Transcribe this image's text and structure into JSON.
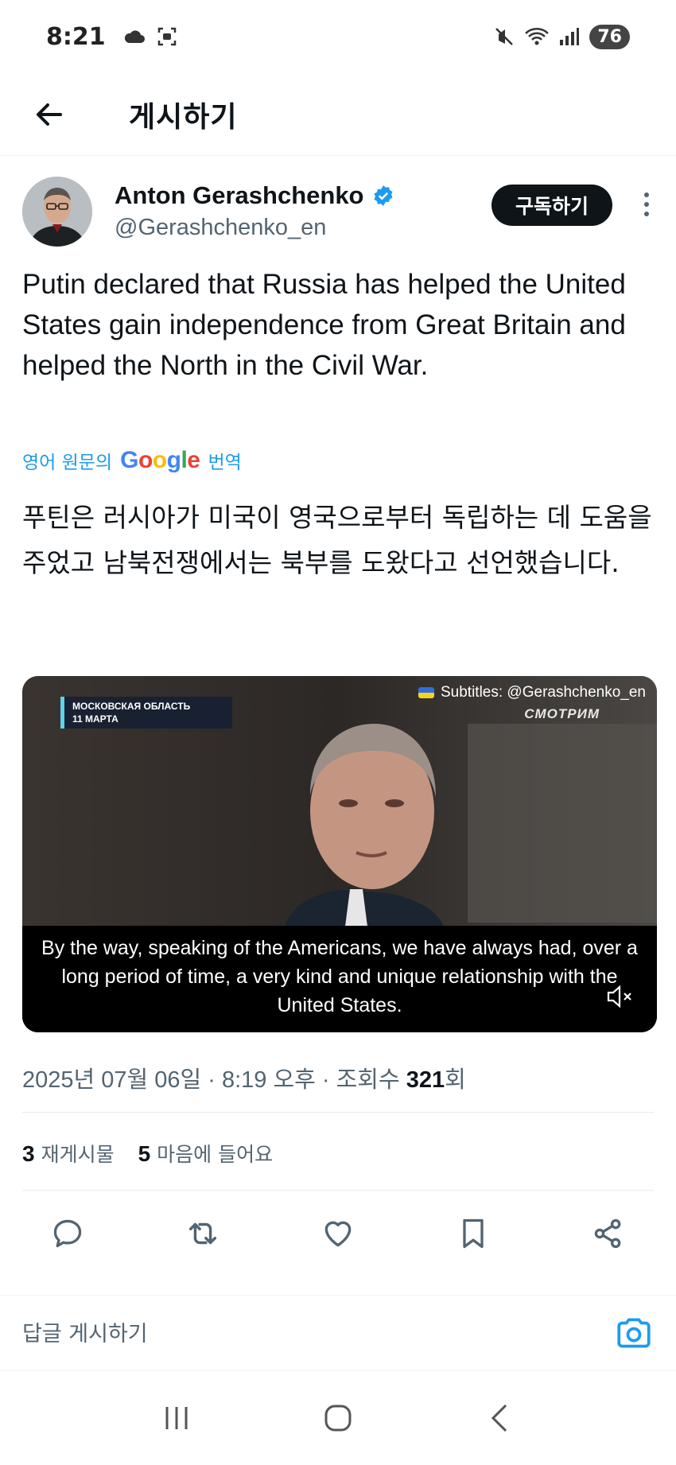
{
  "status_bar": {
    "time": "8:21",
    "battery": "76"
  },
  "header": {
    "title": "게시하기"
  },
  "author": {
    "name": "Anton Gerashchenko",
    "handle": "@Gerashchenko_en",
    "subscribe_label": "구독하기"
  },
  "tweet": {
    "text": "Putin declared that Russia has helped the United States gain independence from Great Britain and helped the North in the Civil War.",
    "translate_prefix": "영어 원문의",
    "translate_brand": "Google",
    "translate_suffix": "번역",
    "translated_text": "푸틴은 러시아가 미국이 영국으로부터 독립하는 데 도움을 주었고 남북전쟁에서는 북부를 도왔다고 선언했습니다.",
    "meta_prefix": "2025년 07월 06일 · 8:19 오후 · 조회수 ",
    "views": "321",
    "meta_suffix": "회"
  },
  "video": {
    "tag_line1": "МОСКОВСКАЯ ОБЛАСТЬ",
    "tag_line2": "11 МАРТА",
    "subtitle_credit": "Subtitles: @Gerashchenko_en",
    "brand": "СМОТРИМ",
    "caption": "By the way, speaking of the Americans, we have always had, over a long period of time, a very kind and unique relationship with the United States."
  },
  "stats": {
    "reposts_count": "3",
    "reposts_label": "재게시물",
    "likes_count": "5",
    "likes_label": "마음에 들어요"
  },
  "reply": {
    "placeholder": "답글 게시하기"
  },
  "colors": {
    "accent": "#1d9bf0",
    "text": "#0f1419",
    "secondary": "#536471",
    "verified": "#1d9bf0"
  },
  "icons": [
    "arrow-left-icon",
    "verified-badge-icon",
    "more-vertical-icon",
    "reply-icon",
    "repost-icon",
    "like-icon",
    "bookmark-icon",
    "share-icon",
    "camera-icon",
    "mute-icon"
  ]
}
